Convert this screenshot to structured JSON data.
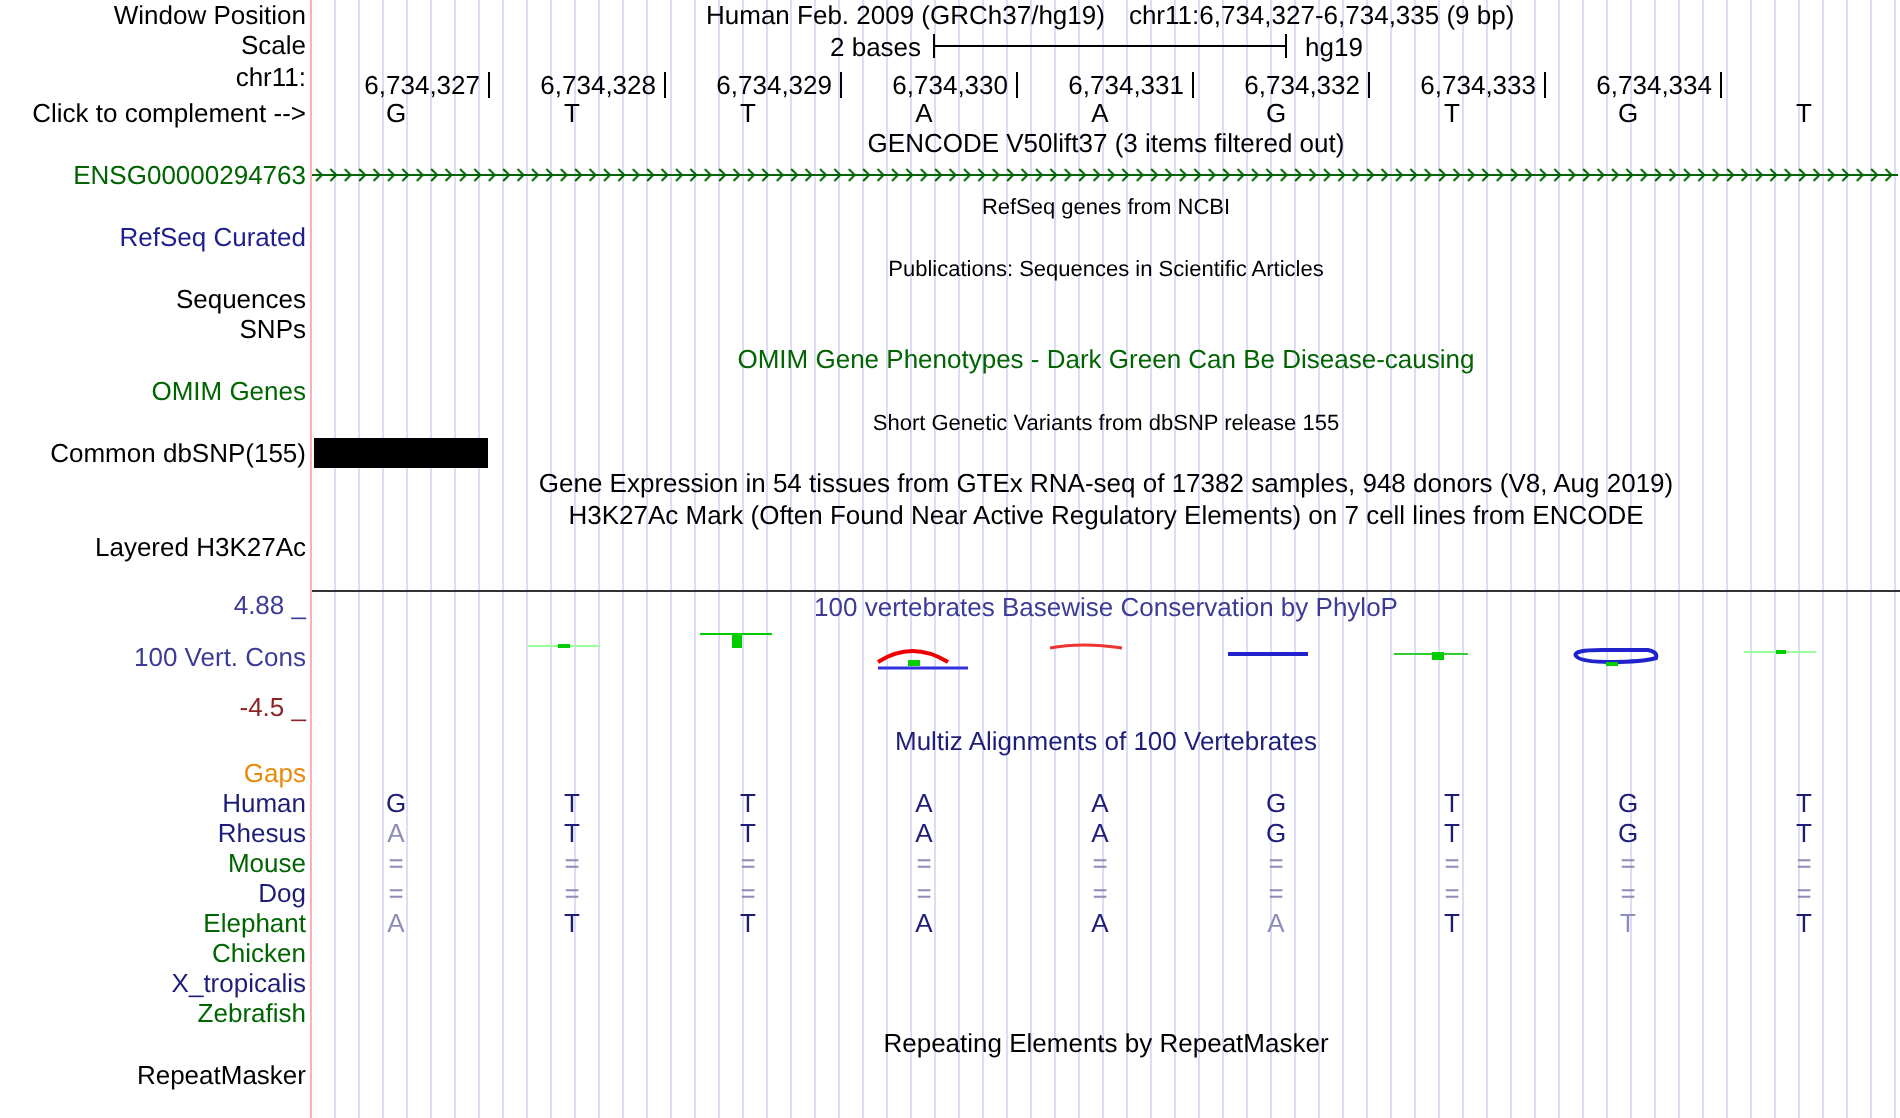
{
  "header": {
    "label": "Window Position",
    "assembly": "Human Feb. 2009 (GRCh37/hg19)",
    "region": "chr11:6,734,327-6,734,335 (9 bp)"
  },
  "scale": {
    "label": "Scale",
    "length": "2 bases",
    "assembly": "hg19"
  },
  "ruler": {
    "label": "chr11:",
    "positions": [
      "6,734,327",
      "6,734,328",
      "6,734,329",
      "6,734,330",
      "6,734,331",
      "6,734,332",
      "6,734,333",
      "6,734,334"
    ]
  },
  "sequence": {
    "label": "Click to complement -->",
    "bases": [
      "G",
      "T",
      "T",
      "A",
      "A",
      "G",
      "T",
      "G",
      "T"
    ]
  },
  "rows": [
    {
      "kind": "title",
      "text": "GENCODE V50lift37 (3 items filtered out)",
      "color": "#000000"
    },
    {
      "kind": "gene",
      "label": "ENSG00000294763",
      "color": "#006400"
    },
    {
      "kind": "small_title",
      "text": "RefSeq genes from NCBI",
      "color": "#000000"
    },
    {
      "kind": "label",
      "label": "RefSeq Curated",
      "color": "#1e1e8c"
    },
    {
      "kind": "small_title",
      "text": "Publications: Sequences in Scientific Articles",
      "color": "#000000"
    },
    {
      "kind": "label",
      "label": "Sequences",
      "color": "#000000"
    },
    {
      "kind": "label",
      "label": "SNPs",
      "color": "#000000"
    },
    {
      "kind": "title",
      "text": "OMIM Gene Phenotypes - Dark Green Can Be Disease-causing",
      "color": "#006400"
    },
    {
      "kind": "label",
      "label": "OMIM Genes",
      "color": "#006400"
    },
    {
      "kind": "small_title",
      "text": "Short Genetic Variants from dbSNP release 155",
      "color": "#000000"
    },
    {
      "kind": "variant",
      "label": "Common dbSNP(155)",
      "color": "#000000"
    },
    {
      "kind": "title",
      "text": "Gene Expression in 54 tissues from GTEx RNA-seq of 17382 samples, 948 donors (V8, Aug 2019)",
      "color": "#000000"
    },
    {
      "kind": "title",
      "text": "H3K27Ac Mark (Often Found Near Active Regulatory Elements) on 7 cell lines from ENCODE",
      "color": "#000000"
    },
    {
      "kind": "label",
      "label": "Layered H3K27Ac",
      "color": "#000000"
    },
    {
      "kind": "conservation",
      "title": "100 vertebrates Basewise Conservation by PhyloP",
      "max": "4.88 _",
      "label": "100 Vert. Cons",
      "min": "-4.5 _",
      "color": "#3c3c96"
    },
    {
      "kind": "title",
      "text": "Multiz Alignments of 100 Vertebrates",
      "color": "#1e1e78"
    },
    {
      "kind": "species",
      "label": "Gaps",
      "color": "#e8890c"
    },
    {
      "kind": "species",
      "label": "Human",
      "color": "#1e1e78",
      "bases": [
        {
          "base": "G",
          "faded": false
        },
        {
          "base": "T",
          "faded": false
        },
        {
          "base": "T",
          "faded": false
        },
        {
          "base": "A",
          "faded": false
        },
        {
          "base": "A",
          "faded": false
        },
        {
          "base": "G",
          "faded": false
        },
        {
          "base": "T",
          "faded": false
        },
        {
          "base": "G",
          "faded": false
        },
        {
          "base": "T",
          "faded": false
        }
      ]
    },
    {
      "kind": "species",
      "label": "Rhesus",
      "color": "#1e1e78",
      "bases": [
        {
          "base": "A",
          "faded": true
        },
        {
          "base": "T",
          "faded": false
        },
        {
          "base": "T",
          "faded": false
        },
        {
          "base": "A",
          "faded": false
        },
        {
          "base": "A",
          "faded": false
        },
        {
          "base": "G",
          "faded": false
        },
        {
          "base": "T",
          "faded": false
        },
        {
          "base": "G",
          "faded": false
        },
        {
          "base": "T",
          "faded": false
        }
      ]
    },
    {
      "kind": "species",
      "label": "Mouse",
      "color": "#006400",
      "bases": [
        {
          "base": "=",
          "faded": true
        },
        {
          "base": "=",
          "faded": true
        },
        {
          "base": "=",
          "faded": true
        },
        {
          "base": "=",
          "faded": true
        },
        {
          "base": "=",
          "faded": true
        },
        {
          "base": "=",
          "faded": true
        },
        {
          "base": "=",
          "faded": true
        },
        {
          "base": "=",
          "faded": true
        },
        {
          "base": "=",
          "faded": true
        }
      ]
    },
    {
      "kind": "species",
      "label": "Dog",
      "color": "#1e1e78",
      "bases": [
        {
          "base": "=",
          "faded": true
        },
        {
          "base": "=",
          "faded": true
        },
        {
          "base": "=",
          "faded": true
        },
        {
          "base": "=",
          "faded": true
        },
        {
          "base": "=",
          "faded": true
        },
        {
          "base": "=",
          "faded": true
        },
        {
          "base": "=",
          "faded": true
        },
        {
          "base": "=",
          "faded": true
        },
        {
          "base": "=",
          "faded": true
        }
      ]
    },
    {
      "kind": "species",
      "label": "Elephant",
      "color": "#006400",
      "bases": [
        {
          "base": "A",
          "faded": true
        },
        {
          "base": "T",
          "faded": false
        },
        {
          "base": "T",
          "faded": false
        },
        {
          "base": "A",
          "faded": false
        },
        {
          "base": "A",
          "faded": false
        },
        {
          "base": "A",
          "faded": true
        },
        {
          "base": "T",
          "faded": false
        },
        {
          "base": "T",
          "faded": true
        },
        {
          "base": "T",
          "faded": false
        }
      ]
    },
    {
      "kind": "species",
      "label": "Chicken",
      "color": "#006400"
    },
    {
      "kind": "species",
      "label": "X_tropicalis",
      "color": "#1e1e78"
    },
    {
      "kind": "species",
      "label": "Zebrafish",
      "color": "#006400"
    },
    {
      "kind": "title",
      "text": "Repeating Elements by RepeatMasker",
      "color": "#000000"
    },
    {
      "kind": "label",
      "label": "RepeatMasker",
      "color": "#000000"
    }
  ]
}
